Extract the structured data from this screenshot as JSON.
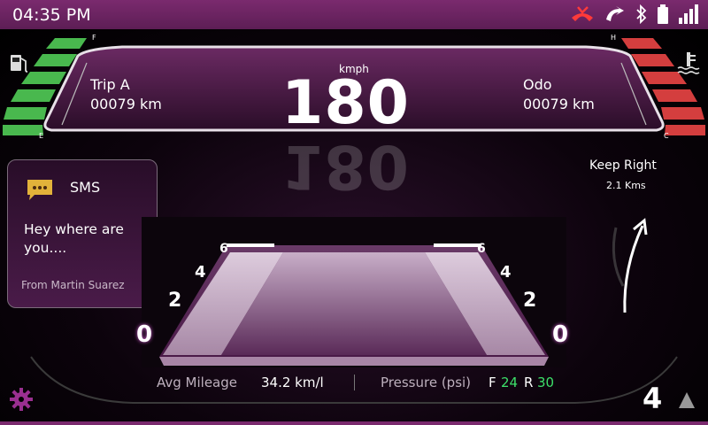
{
  "status": {
    "time": "04:35 PM",
    "icons": [
      "missed-call-icon",
      "nav-icon",
      "bluetooth-icon",
      "battery-icon",
      "signal-icon"
    ]
  },
  "fuel": {
    "full_label": "F",
    "empty_label": "E"
  },
  "temp": {
    "hot_label": "H",
    "cold_label": "C"
  },
  "speed": {
    "unit": "kmph",
    "value": "180"
  },
  "trip": {
    "label": "Trip A",
    "value": "00079 km"
  },
  "odo": {
    "label": "Odo",
    "value": "00079 km"
  },
  "sms": {
    "title": "SMS",
    "message": "Hey where are you....",
    "from": "From Martin Suarez"
  },
  "nav": {
    "instruction": "Keep Right",
    "distance": "2.1 Kms"
  },
  "road_marks": {
    "left": [
      "6",
      "4",
      "2",
      "0"
    ],
    "right": [
      "6",
      "4",
      "2",
      "0"
    ]
  },
  "footer": {
    "mileage_label": "Avg Mileage",
    "mileage_value": "34.2 km/l",
    "pressure_label": "Pressure (psi)",
    "front_label": "F",
    "front_value": "24",
    "rear_label": "R",
    "rear_value": "30",
    "gear": "4"
  },
  "colors": {
    "accent": "#7a2a6e",
    "fuel": "#43b649",
    "temp": "#d03a3a",
    "pressure": "#3de06a"
  }
}
